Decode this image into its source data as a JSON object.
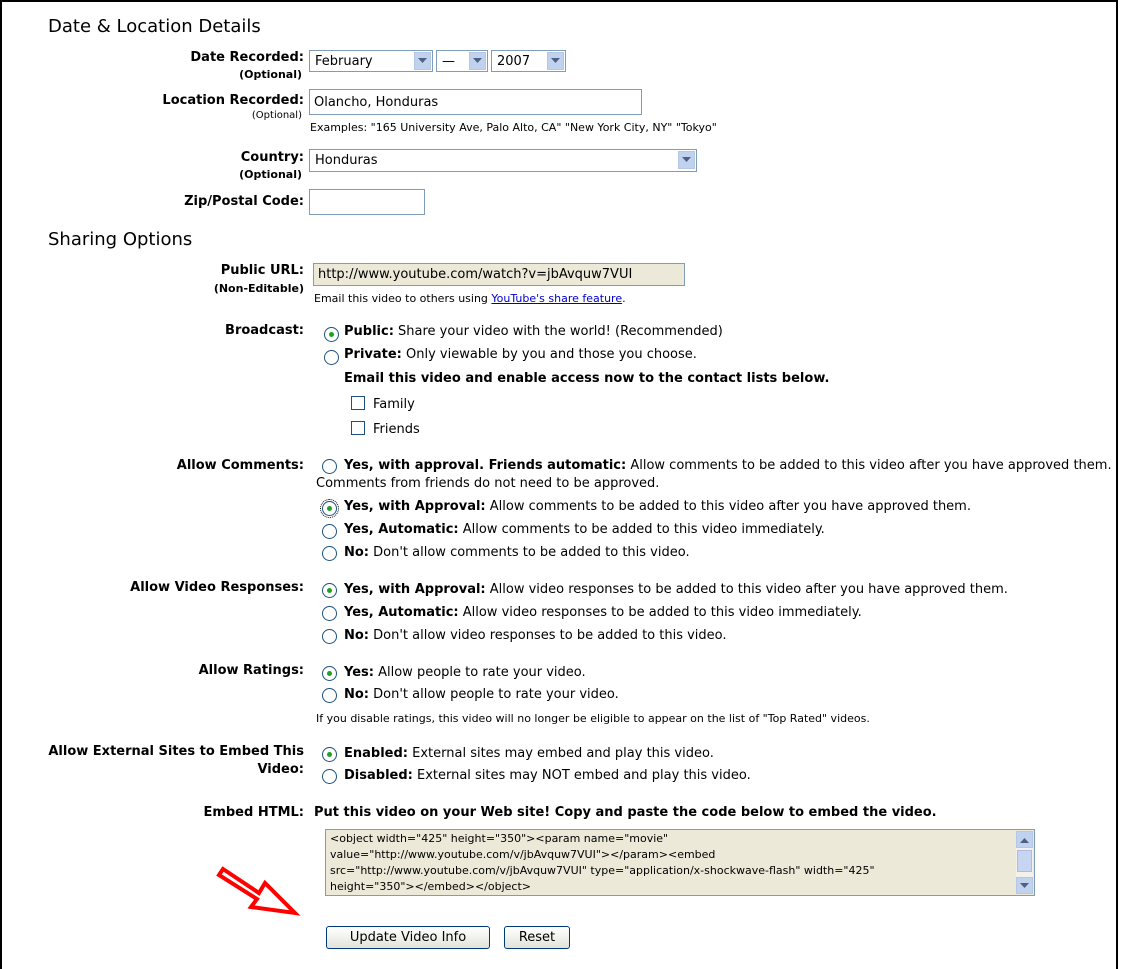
{
  "date_location": {
    "heading": "Date & Location Details",
    "date_label": "Date Recorded:",
    "date_sub": "(Optional)",
    "month": "February",
    "day": "—",
    "year": "2007",
    "location_label": "Location Recorded:",
    "location_sub": "(Optional)",
    "location_value": "Olancho, Honduras",
    "location_examples": "Examples: \"165 University Ave, Palo Alto, CA\"   \"New York City, NY\"   \"Tokyo\"",
    "country_label": "Country:",
    "country_sub": "(Optional)",
    "country_value": "Honduras",
    "zip_label": "Zip/Postal Code:",
    "zip_value": ""
  },
  "sharing": {
    "heading": "Sharing Options",
    "public_url_label": "Public URL:",
    "public_url_sub": "(Non-Editable)",
    "public_url_value": "http://www.youtube.com/watch?v=jbAvquw7VUI",
    "share_text": "Email this video to others using ",
    "share_link": "YouTube's share feature",
    "share_end": ".",
    "broadcast_label": "Broadcast:",
    "public_b": "Public:",
    "public_t": " Share your video with the world! (Recommended)",
    "private_b": "Private:",
    "private_t": " Only viewable by you and those you choose.",
    "email_contacts": "Email this video and enable access now to the contact lists below.",
    "family": "Family",
    "friends": "Friends",
    "comments_label": "Allow Comments:",
    "c1_b": "Yes, with approval. Friends automatic:",
    "c1_t": " Allow comments to be added to this video after you have approved them.",
    "c1_t2": "Comments from friends do not need to be approved.",
    "c2_b": "Yes, with Approval:",
    "c2_t": " Allow comments to be added to this video after you have approved them.",
    "c3_b": "Yes, Automatic:",
    "c3_t": " Allow comments to be added to this video immediately.",
    "c4_b": "No:",
    "c4_t": " Don't allow comments to be added to this video.",
    "responses_label": "Allow Video Responses:",
    "r1_b": "Yes, with Approval:",
    "r1_t": " Allow video responses to be added to this video after you have approved them.",
    "r2_b": "Yes, Automatic:",
    "r2_t": " Allow video responses to be added to this video immediately.",
    "r3_b": "No:",
    "r3_t": " Don't allow video responses to be added to this video.",
    "ratings_label": "Allow Ratings:",
    "ra1_b": "Yes:",
    "ra1_t": " Allow people to rate your video.",
    "ra2_b": "No:",
    "ra2_t": " Don't allow people to rate your video.",
    "ratings_note": "If you disable ratings, this video will no longer be eligible to appear on the list of \"Top Rated\" videos.",
    "embed_label_1": "Allow External Sites to Embed This",
    "embed_label_2": "Video:",
    "e1_b": "Enabled:",
    "e1_t": " External sites may embed and play this video.",
    "e2_b": "Disabled:",
    "e2_t": " External sites may NOT embed and play this video.",
    "embed_html_label": "Embed HTML:",
    "embed_html_desc": "Put this video on your Web site! Copy and paste the code below to embed the video.",
    "embed_code_1": "<object width=\"425\" height=\"350\"><param name=\"movie\"",
    "embed_code_2": "value=\"http://www.youtube.com/v/jbAvquw7VUI\"></param><embed",
    "embed_code_3": "src=\"http://www.youtube.com/v/jbAvquw7VUI\" type=\"application/x-shockwave-flash\" width=\"425\"",
    "embed_code_4": "height=\"350\"></embed></object>",
    "update_button": "Update Video Info",
    "reset_button": "Reset"
  },
  "colors": {
    "arrow": "#ff0000",
    "link": "#0000cc"
  },
  "icons": [
    "chevron-down-icon",
    "scroll-up-icon",
    "scroll-down-icon",
    "red-arrow-icon"
  ]
}
